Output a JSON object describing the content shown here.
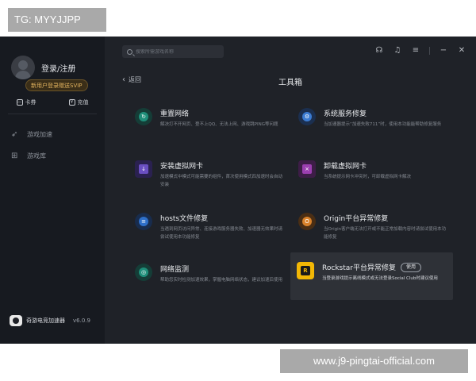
{
  "watermarks": {
    "top": "TG: MYYJJPP",
    "bottom": "www.j9-pingtai-official.com"
  },
  "sidebar": {
    "login_label": "登录/注册",
    "vip_badge": "新用户登录赠送SVIP",
    "actions": [
      {
        "label": "卡券",
        "icon": "card-icon"
      },
      {
        "label": "充值",
        "icon": "recharge-icon"
      }
    ],
    "nav": [
      {
        "label": "游戏加速",
        "icon": "rocket-icon"
      },
      {
        "label": "游戏库",
        "icon": "gamepad-icon"
      }
    ],
    "brand": {
      "name": "奇游电竞加速器",
      "version": "v6.0.9"
    }
  },
  "topbar": {
    "search_placeholder": "搜索所需游戏名称",
    "icons": [
      "headset-icon",
      "bell-icon",
      "menu-icon",
      "minimize-icon",
      "close-icon"
    ]
  },
  "header": {
    "back_label": "返回",
    "title": "工具箱"
  },
  "tools": [
    {
      "name": "重置网络",
      "desc": "解决打不开网页、登不上QQ、无法上网、游戏跳PING等问题",
      "icon": "reset-network-icon",
      "color": "#1f8f7a"
    },
    {
      "name": "系统服务修复",
      "desc": "当加速器提示“加速失败711”时，使用本功能能帮助修复服务",
      "icon": "system-service-icon",
      "color": "#3b7bd1"
    },
    {
      "name": "安装虚拟网卡",
      "desc": "加速模式中模式可能需要的组件，首次使用模式四加速时会自动安装",
      "icon": "install-nic-icon",
      "color": "#6a4fc2"
    },
    {
      "name": "卸载虚拟网卡",
      "desc": "当系统提示网卡冲突时，可卸载虚拟网卡解决",
      "icon": "uninstall-nic-icon",
      "color": "#9b3fb0"
    },
    {
      "name": "hosts文件修复",
      "desc": "当遇到网页访问异常、连接游戏服务器失败、加速器无效果时请尝试使用本功能修复",
      "icon": "hosts-icon",
      "color": "#2e6fc9"
    },
    {
      "name": "Origin平台异常修复",
      "desc": "当Origin客户端无法打开或不能正常加载内容时请尝试使用本功能修复",
      "icon": "origin-icon",
      "color": "#d9822b"
    },
    {
      "name": "网络监测",
      "desc": "帮助您实时检测加速效果，掌握电脑网络状态，建议加速后使用",
      "icon": "network-monitor-icon",
      "color": "#1f8f7a"
    },
    {
      "name": "Rockstar平台异常修复",
      "desc": "当登录游戏提示离线模式或无法登录Social Club时建议使用",
      "icon": "rockstar-icon",
      "color": "#f2b705",
      "action": "使用"
    }
  ]
}
